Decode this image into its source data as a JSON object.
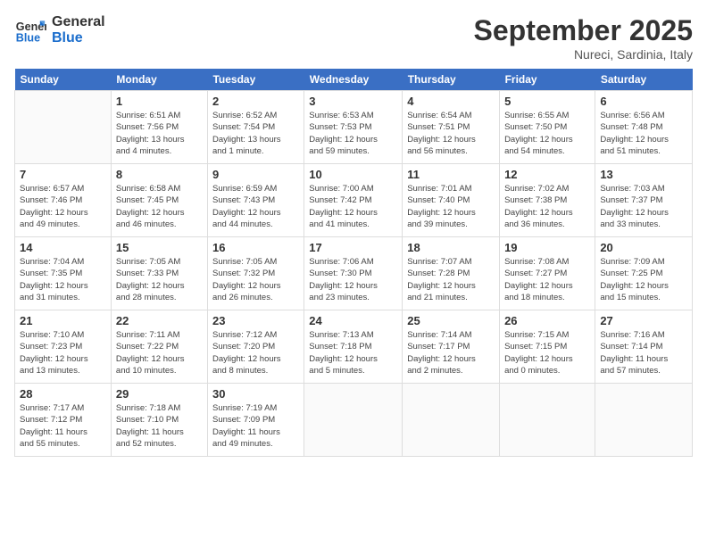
{
  "logo": {
    "line1": "General",
    "line2": "Blue"
  },
  "title": "September 2025",
  "location": "Nureci, Sardinia, Italy",
  "days_of_week": [
    "Sunday",
    "Monday",
    "Tuesday",
    "Wednesday",
    "Thursday",
    "Friday",
    "Saturday"
  ],
  "weeks": [
    [
      {
        "day": "",
        "info": ""
      },
      {
        "day": "1",
        "info": "Sunrise: 6:51 AM\nSunset: 7:56 PM\nDaylight: 13 hours\nand 4 minutes."
      },
      {
        "day": "2",
        "info": "Sunrise: 6:52 AM\nSunset: 7:54 PM\nDaylight: 13 hours\nand 1 minute."
      },
      {
        "day": "3",
        "info": "Sunrise: 6:53 AM\nSunset: 7:53 PM\nDaylight: 12 hours\nand 59 minutes."
      },
      {
        "day": "4",
        "info": "Sunrise: 6:54 AM\nSunset: 7:51 PM\nDaylight: 12 hours\nand 56 minutes."
      },
      {
        "day": "5",
        "info": "Sunrise: 6:55 AM\nSunset: 7:50 PM\nDaylight: 12 hours\nand 54 minutes."
      },
      {
        "day": "6",
        "info": "Sunrise: 6:56 AM\nSunset: 7:48 PM\nDaylight: 12 hours\nand 51 minutes."
      }
    ],
    [
      {
        "day": "7",
        "info": "Sunrise: 6:57 AM\nSunset: 7:46 PM\nDaylight: 12 hours\nand 49 minutes."
      },
      {
        "day": "8",
        "info": "Sunrise: 6:58 AM\nSunset: 7:45 PM\nDaylight: 12 hours\nand 46 minutes."
      },
      {
        "day": "9",
        "info": "Sunrise: 6:59 AM\nSunset: 7:43 PM\nDaylight: 12 hours\nand 44 minutes."
      },
      {
        "day": "10",
        "info": "Sunrise: 7:00 AM\nSunset: 7:42 PM\nDaylight: 12 hours\nand 41 minutes."
      },
      {
        "day": "11",
        "info": "Sunrise: 7:01 AM\nSunset: 7:40 PM\nDaylight: 12 hours\nand 39 minutes."
      },
      {
        "day": "12",
        "info": "Sunrise: 7:02 AM\nSunset: 7:38 PM\nDaylight: 12 hours\nand 36 minutes."
      },
      {
        "day": "13",
        "info": "Sunrise: 7:03 AM\nSunset: 7:37 PM\nDaylight: 12 hours\nand 33 minutes."
      }
    ],
    [
      {
        "day": "14",
        "info": "Sunrise: 7:04 AM\nSunset: 7:35 PM\nDaylight: 12 hours\nand 31 minutes."
      },
      {
        "day": "15",
        "info": "Sunrise: 7:05 AM\nSunset: 7:33 PM\nDaylight: 12 hours\nand 28 minutes."
      },
      {
        "day": "16",
        "info": "Sunrise: 7:05 AM\nSunset: 7:32 PM\nDaylight: 12 hours\nand 26 minutes."
      },
      {
        "day": "17",
        "info": "Sunrise: 7:06 AM\nSunset: 7:30 PM\nDaylight: 12 hours\nand 23 minutes."
      },
      {
        "day": "18",
        "info": "Sunrise: 7:07 AM\nSunset: 7:28 PM\nDaylight: 12 hours\nand 21 minutes."
      },
      {
        "day": "19",
        "info": "Sunrise: 7:08 AM\nSunset: 7:27 PM\nDaylight: 12 hours\nand 18 minutes."
      },
      {
        "day": "20",
        "info": "Sunrise: 7:09 AM\nSunset: 7:25 PM\nDaylight: 12 hours\nand 15 minutes."
      }
    ],
    [
      {
        "day": "21",
        "info": "Sunrise: 7:10 AM\nSunset: 7:23 PM\nDaylight: 12 hours\nand 13 minutes."
      },
      {
        "day": "22",
        "info": "Sunrise: 7:11 AM\nSunset: 7:22 PM\nDaylight: 12 hours\nand 10 minutes."
      },
      {
        "day": "23",
        "info": "Sunrise: 7:12 AM\nSunset: 7:20 PM\nDaylight: 12 hours\nand 8 minutes."
      },
      {
        "day": "24",
        "info": "Sunrise: 7:13 AM\nSunset: 7:18 PM\nDaylight: 12 hours\nand 5 minutes."
      },
      {
        "day": "25",
        "info": "Sunrise: 7:14 AM\nSunset: 7:17 PM\nDaylight: 12 hours\nand 2 minutes."
      },
      {
        "day": "26",
        "info": "Sunrise: 7:15 AM\nSunset: 7:15 PM\nDaylight: 12 hours\nand 0 minutes."
      },
      {
        "day": "27",
        "info": "Sunrise: 7:16 AM\nSunset: 7:14 PM\nDaylight: 11 hours\nand 57 minutes."
      }
    ],
    [
      {
        "day": "28",
        "info": "Sunrise: 7:17 AM\nSunset: 7:12 PM\nDaylight: 11 hours\nand 55 minutes."
      },
      {
        "day": "29",
        "info": "Sunrise: 7:18 AM\nSunset: 7:10 PM\nDaylight: 11 hours\nand 52 minutes."
      },
      {
        "day": "30",
        "info": "Sunrise: 7:19 AM\nSunset: 7:09 PM\nDaylight: 11 hours\nand 49 minutes."
      },
      {
        "day": "",
        "info": ""
      },
      {
        "day": "",
        "info": ""
      },
      {
        "day": "",
        "info": ""
      },
      {
        "day": "",
        "info": ""
      }
    ]
  ]
}
